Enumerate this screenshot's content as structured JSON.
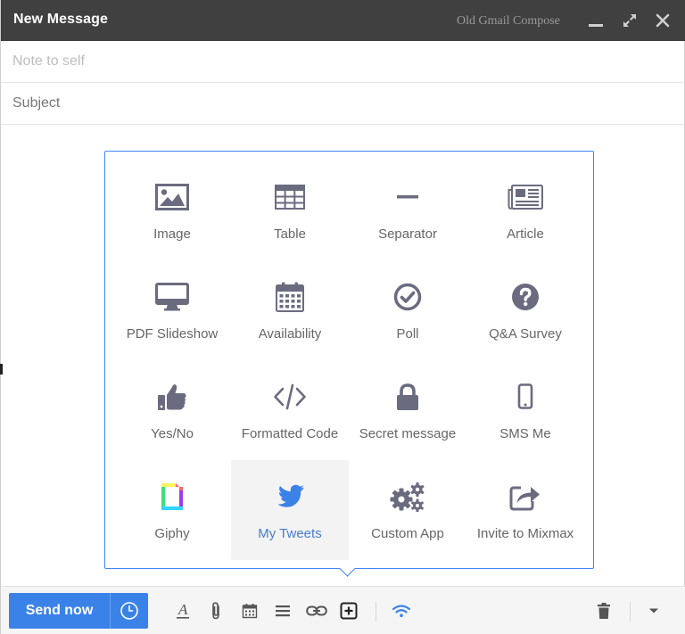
{
  "window": {
    "title": "New Message",
    "old_compose_label": "Old Gmail Compose"
  },
  "fields": {
    "to_placeholder": "Note to self",
    "subject_placeholder": "Subject"
  },
  "insert_menu": {
    "rows": [
      [
        {
          "label": "Image",
          "icon": "image-icon"
        },
        {
          "label": "Table",
          "icon": "table-icon"
        },
        {
          "label": "Separator",
          "icon": "separator-icon"
        },
        {
          "label": "Article",
          "icon": "article-icon"
        }
      ],
      [
        {
          "label": "PDF Slideshow",
          "icon": "monitor-icon"
        },
        {
          "label": "Availability",
          "icon": "calendar-icon"
        },
        {
          "label": "Poll",
          "icon": "check-circle-icon"
        },
        {
          "label": "Q&A Survey",
          "icon": "question-circle-icon"
        }
      ],
      [
        {
          "label": "Yes/No",
          "icon": "thumbs-up-icon"
        },
        {
          "label": "Formatted Code",
          "icon": "code-icon"
        },
        {
          "label": "Secret message",
          "icon": "lock-icon"
        },
        {
          "label": "SMS Me",
          "icon": "phone-icon"
        }
      ],
      [
        {
          "label": "Giphy",
          "icon": "giphy-icon"
        },
        {
          "label": "My Tweets",
          "icon": "twitter-icon",
          "active": true
        },
        {
          "label": "Custom App",
          "icon": "gears-icon"
        },
        {
          "label": "Invite to Mixmax",
          "icon": "share-icon"
        }
      ]
    ]
  },
  "toolbar": {
    "send_label": "Send now"
  },
  "colors": {
    "titlebar": "#404040",
    "accent": "#3b82e8",
    "icon_gray": "#6b6b80",
    "popup_border": "#4285f4",
    "active_label": "#4a7cd0"
  }
}
